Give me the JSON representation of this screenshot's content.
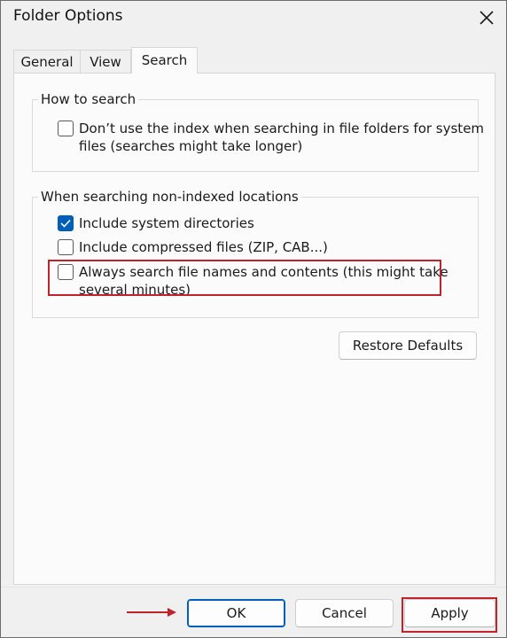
{
  "window": {
    "title": "Folder Options",
    "close_icon": "close-icon"
  },
  "tabs": [
    {
      "label": "General",
      "active": false
    },
    {
      "label": "View",
      "active": false
    },
    {
      "label": "Search",
      "active": true
    }
  ],
  "how_to_search": {
    "legend": "How to search",
    "options": [
      {
        "line1": "Don’t use the index when searching in file folders for system",
        "line2": "files (searches might take longer)",
        "checked": false
      }
    ]
  },
  "non_indexed": {
    "legend": "When searching non-indexed locations",
    "options": [
      {
        "line1": "Include system directories",
        "checked": true
      },
      {
        "line1": "Include compressed files (ZIP, CAB...)",
        "checked": false
      },
      {
        "line1": "Always search file names and contents (this might take",
        "line2": "several minutes)",
        "checked": false,
        "highlighted": true
      }
    ]
  },
  "restore_defaults_label": "Restore Defaults",
  "footer": {
    "ok_label": "OK",
    "cancel_label": "Cancel",
    "apply_label": "Apply"
  },
  "colors": {
    "accent": "#005fb8",
    "annotation": "#c0232c"
  }
}
